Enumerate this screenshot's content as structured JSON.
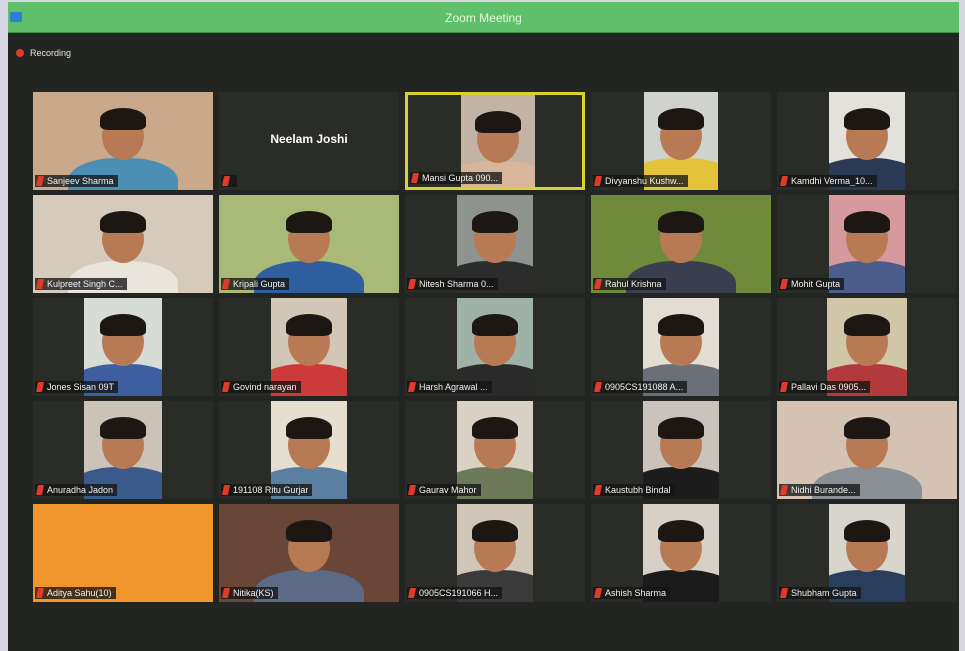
{
  "window": {
    "title": "Zoom Meeting",
    "title_bar_color": "#5fbf6b"
  },
  "recording": {
    "label": "Recording",
    "dot_color": "#e23a2a"
  },
  "participants": [
    {
      "name": "Sanjeev Sharma",
      "video": true,
      "bg": "#c9a98a",
      "shirt": "#4c8fb5"
    },
    {
      "name": "Neelam Joshi",
      "video": false
    },
    {
      "name": "Mansi Gupta 090...",
      "video": true,
      "bg": "#c2b3a4",
      "shirt": "#d9b59c",
      "active": true
    },
    {
      "name": "Divyanshu Kushw...",
      "video": true,
      "bg": "#cfd2cf",
      "shirt": "#e4c33b"
    },
    {
      "name": "Kamdhi Verma_10...",
      "video": true,
      "bg": "#e3e1dc",
      "shirt": "#2a3a55"
    },
    {
      "name": "Kulpreet Singh C...",
      "video": true,
      "bg": "#d6cbbb",
      "shirt": "#e9e4dc"
    },
    {
      "name": "Kripali Gupta",
      "video": true,
      "bg": "#a9b978",
      "shirt": "#2f5f9e"
    },
    {
      "name": "Nitesh Sharma 0...",
      "video": true,
      "bg": "#8f938f",
      "shirt": "#2c2c2c"
    },
    {
      "name": "Rahul Krishna",
      "video": true,
      "bg": "#6e8a3a",
      "shirt": "#3a3f4f"
    },
    {
      "name": "Mohit Gupta",
      "video": true,
      "bg": "#d69a9e",
      "shirt": "#4a5d8c"
    },
    {
      "name": "Jones Sisan 09T",
      "video": true,
      "bg": "#d8dcd7",
      "shirt": "#3d5fa0"
    },
    {
      "name": "Govind narayan",
      "video": true,
      "bg": "#d2c6b6",
      "shirt": "#cc3a3a"
    },
    {
      "name": "Harsh Agrawal ...",
      "video": true,
      "bg": "#9eb2a8",
      "shirt": "#2a2a2a"
    },
    {
      "name": "0905CS191088 A...",
      "video": true,
      "bg": "#e2ddd3",
      "shirt": "#6a6f7a"
    },
    {
      "name": "Pallavi Das 0905...",
      "video": true,
      "bg": "#d0c7a8",
      "shirt": "#b23a3a"
    },
    {
      "name": "Anuradha Jadon",
      "video": true,
      "bg": "#cbc3b7",
      "shirt": "#3a5a8a"
    },
    {
      "name": "191108 Ritu Gurjar",
      "video": true,
      "bg": "#e6dfd0",
      "shirt": "#5a7fa0"
    },
    {
      "name": "Gaurav Mahor",
      "video": true,
      "bg": "#d9d2c4",
      "shirt": "#6c7a5a"
    },
    {
      "name": "Kaustubh Bindal",
      "video": true,
      "bg": "#c9c3bb",
      "shirt": "#1c1c1c"
    },
    {
      "name": "Nidhi Burande...",
      "video": true,
      "bg": "#d4c3b3",
      "shirt": "#8a8f96"
    },
    {
      "name": "Aditya Sahu(10)",
      "video": false,
      "solid": "#f0962d"
    },
    {
      "name": "Nitika(KS)",
      "video": true,
      "bg": "#6a4638",
      "shirt": "#5c6a86"
    },
    {
      "name": "0905CS191066 H...",
      "video": true,
      "bg": "#cfc6b8",
      "shirt": "#3a3a3a"
    },
    {
      "name": "Ashish Sharma",
      "video": true,
      "bg": "#d6d0c6",
      "shirt": "#1b1b1b"
    },
    {
      "name": "Shubham Gupta",
      "video": true,
      "bg": "#d8d5cc",
      "shirt": "#2b3d5c"
    }
  ]
}
